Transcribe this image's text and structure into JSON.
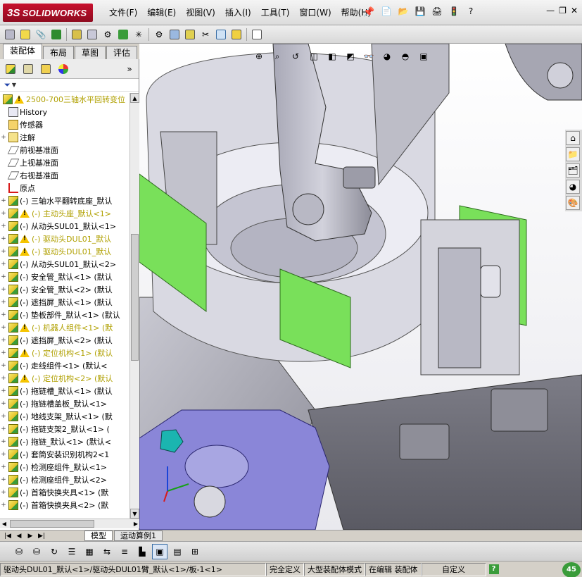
{
  "app": {
    "logo_prefix": "3S",
    "logo_text": "SOLIDWORKS"
  },
  "menu": [
    "文件(F)",
    "编辑(E)",
    "视图(V)",
    "插入(I)",
    "工具(T)",
    "窗口(W)",
    "帮助(H)"
  ],
  "feature_tabs": [
    "装配体",
    "布局",
    "草图",
    "评估"
  ],
  "tree": {
    "filter_symbol": "▼",
    "root": "2500-700三轴水平回转变位",
    "items": [
      {
        "label": "History",
        "icon": "history-icon",
        "type": "history"
      },
      {
        "label": "传感器",
        "icon": "sensor-icon",
        "type": "folder"
      },
      {
        "label": "注解",
        "icon": "annotation-icon",
        "type": "annot",
        "expand": "+"
      },
      {
        "label": "前视基准面",
        "icon": "plane-icon",
        "type": "plane"
      },
      {
        "label": "上视基准面",
        "icon": "plane-icon",
        "type": "plane"
      },
      {
        "label": "右视基准面",
        "icon": "plane-icon",
        "type": "plane"
      },
      {
        "label": "原点",
        "icon": "origin-icon",
        "type": "origin"
      },
      {
        "label": "(-) 三轴水平翻转底座_默认",
        "type": "comp",
        "expand": "+"
      },
      {
        "label": "(-) 主动头座_默认<1>",
        "type": "warn",
        "expand": "+"
      },
      {
        "label": "(-) 从动头SUL01_默认<1>",
        "type": "comp",
        "expand": "+"
      },
      {
        "label": "(-) 驱动头DUL01_默认",
        "type": "warn",
        "expand": "+"
      },
      {
        "label": "(-) 驱动头DUL01_默认",
        "type": "warn",
        "expand": "+"
      },
      {
        "label": "(-) 从动头SUL01_默认<2>",
        "type": "comp",
        "expand": "+"
      },
      {
        "label": "(-) 安全管_默认<1> (默认",
        "type": "comp",
        "expand": "+"
      },
      {
        "label": "(-) 安全管_默认<2> (默认",
        "type": "comp",
        "expand": "+"
      },
      {
        "label": "(-) 遮挡屏_默认<1> (默认",
        "type": "comp",
        "expand": "+"
      },
      {
        "label": "(-) 垫板部件_默认<1> (默认",
        "type": "comp",
        "expand": "+"
      },
      {
        "label": "(-) 机器人组件<1> (默",
        "type": "warn",
        "expand": "+"
      },
      {
        "label": "(-) 遮挡屏_默认<2> (默认",
        "type": "comp",
        "expand": "+"
      },
      {
        "label": "(-) 定位机构<1> (默认",
        "type": "warn",
        "expand": "+"
      },
      {
        "label": "(-) 走线组件<1> (默认<",
        "type": "comp",
        "expand": "+"
      },
      {
        "label": "(-) 定位机构<2> (默认",
        "type": "warn",
        "expand": "+"
      },
      {
        "label": "(-) 拖链槽_默认<1> (默认",
        "type": "comp",
        "expand": "+"
      },
      {
        "label": "(-) 拖链槽盖板_默认<1>",
        "type": "comp",
        "expand": "+"
      },
      {
        "label": "(-) 地线支架_默认<1> (默",
        "type": "comp",
        "expand": "+"
      },
      {
        "label": "(-) 拖链支架2_默认<1> (",
        "type": "comp",
        "expand": "+"
      },
      {
        "label": "(-) 拖链_默认<1> (默认<",
        "type": "comp",
        "expand": "+"
      },
      {
        "label": "(-) 套筒安装识别机构2<1",
        "type": "comp",
        "expand": "+"
      },
      {
        "label": "(-) 检测座组件_默认<1>",
        "type": "comp",
        "expand": "+"
      },
      {
        "label": "(-) 检测座组件_默认<2>",
        "type": "comp",
        "expand": "+"
      },
      {
        "label": "(-) 首箱快换夹具<1> (默",
        "type": "comp",
        "expand": "+"
      },
      {
        "label": "(-) 首箱快换夹具<2> (默",
        "type": "comp",
        "expand": "+"
      }
    ]
  },
  "model_tabs": [
    "模型",
    "运动算例1"
  ],
  "status": {
    "path": "驱动头DUL01_默认<1>/驱动头DUL01臂_默认<1>/板-1<1>",
    "fully_defined": "完全定义",
    "large_assembly": "大型装配体模式",
    "editing": "在编辑 装配体",
    "custom": "自定义",
    "bubble_num": "45"
  },
  "colors": {
    "green_panel": "#79e05a",
    "machine_gray": "#9a9aa6",
    "blue_part": "#8a86d8",
    "teal_clip": "#1bb5b0",
    "logo_red": "#c8102e"
  }
}
